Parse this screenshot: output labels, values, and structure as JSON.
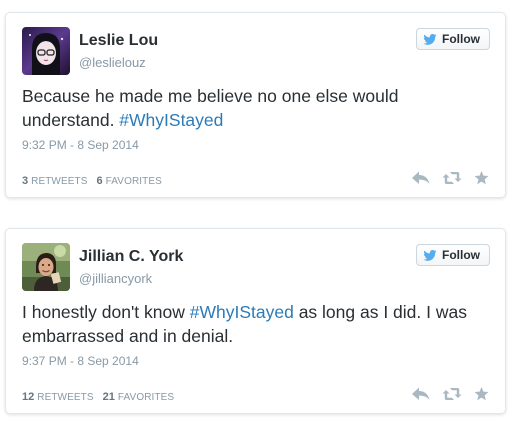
{
  "tweets": [
    {
      "name": "Leslie Lou",
      "handle": "@leslielouz",
      "follow_label": "Follow",
      "text_before": "Because he made me believe no one else would understand. ",
      "hashtag": "#WhyIStayed",
      "text_after": "",
      "time": "9:32 PM - 8 Sep 2014",
      "retweets_count": "3",
      "retweets_label": "RETWEETS",
      "favorites_count": "6",
      "favorites_label": "FAVORITES"
    },
    {
      "name": "Jillian C. York",
      "handle": "@jilliancyork",
      "follow_label": "Follow",
      "text_before": "I honestly don't know ",
      "hashtag": "#WhyIStayed",
      "text_after": " as long as I did. I was embarrassed and in denial.",
      "time": "9:37 PM - 8 Sep 2014",
      "retweets_count": "12",
      "retweets_label": "RETWEETS",
      "favorites_count": "21",
      "favorites_label": "FAVORITES"
    }
  ],
  "colors": {
    "link": "#2b7bb9",
    "muted": "#8899a6",
    "text": "#292f33",
    "twitter_blue": "#55acee"
  },
  "icons": [
    "avatar-leslie",
    "avatar-jillian",
    "twitter-bird-icon",
    "reply-icon",
    "retweet-icon",
    "favorite-icon"
  ]
}
